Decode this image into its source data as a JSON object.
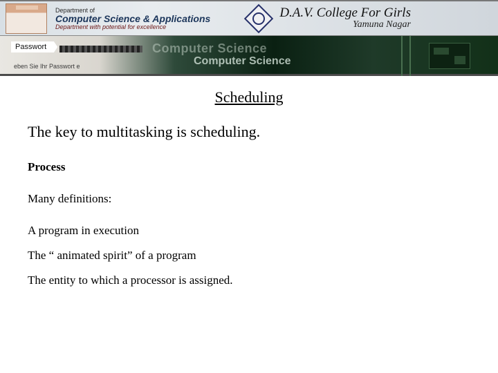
{
  "header": {
    "dept_of": "Department of",
    "dept_name": "Computer Science & Applications",
    "dept_tag": "Department with potential for excellence",
    "college_name": "D.A.V. College For Girls",
    "college_loc": "Yamuna Nagar"
  },
  "banner": {
    "passwort_label": "Passwort",
    "passwort_sub": "eben Sie Ihr Passwort e",
    "cs_line1": "Computer Science",
    "cs_line2": "Computer Science"
  },
  "content": {
    "title": "Scheduling",
    "lead": "The key to multitasking is scheduling.",
    "subhead": "Process",
    "defs_intro": "Many definitions:",
    "defs": [
      "A program in execution",
      "The “ animated spirit” of a program",
      "The entity to which a processor is assigned."
    ]
  }
}
